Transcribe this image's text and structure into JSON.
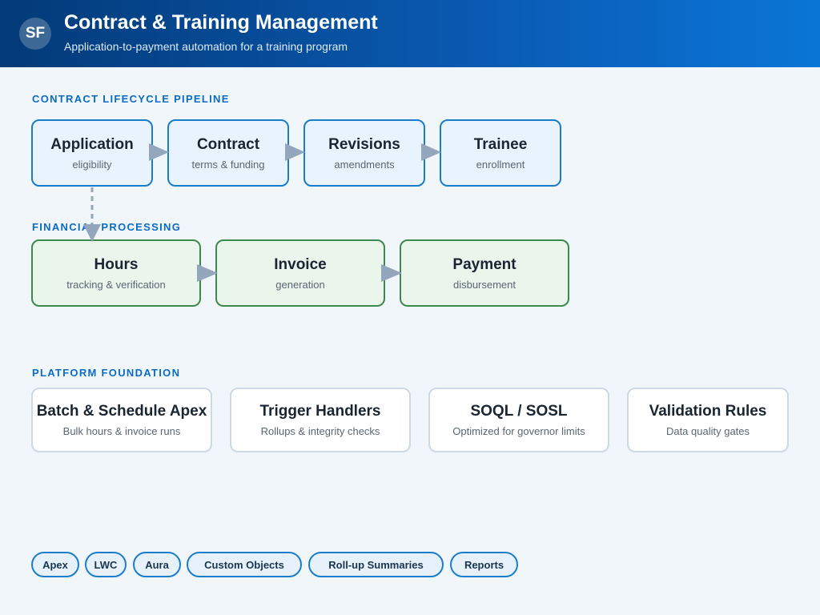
{
  "header": {
    "logo_text": "SF",
    "title": "Contract & Training Management",
    "subtitle": "Application-to-payment automation for a training program"
  },
  "sections": {
    "lifecycle": "CONTRACT LIFECYCLE PIPELINE",
    "financial": "FINANCIAL PROCESSING",
    "platform": "PLATFORM FOUNDATION"
  },
  "lifecycle_nodes": [
    {
      "title": "Application",
      "sub": "eligibility"
    },
    {
      "title": "Contract",
      "sub": "terms & funding"
    },
    {
      "title": "Revisions",
      "sub": "amendments"
    },
    {
      "title": "Trainee",
      "sub": "enrollment"
    }
  ],
  "financial_nodes": [
    {
      "title": "Hours",
      "sub": "tracking & verification"
    },
    {
      "title": "Invoice",
      "sub": "generation"
    },
    {
      "title": "Payment",
      "sub": "disbursement"
    }
  ],
  "platform_nodes": [
    {
      "title": "Batch & Schedule Apex",
      "sub": "Bulk hours & invoice runs"
    },
    {
      "title": "Trigger Handlers",
      "sub": "Rollups & integrity checks"
    },
    {
      "title": "SOQL / SOSL",
      "sub": "Optimized for governor limits"
    },
    {
      "title": "Validation Rules",
      "sub": "Data quality gates"
    }
  ],
  "tags": [
    "Apex",
    "LWC",
    "Aura",
    "Custom Objects",
    "Roll-up Summaries",
    "Reports"
  ],
  "colors": {
    "header_start": "#033a78",
    "header_end": "#0a76d6",
    "accent_blue": "#1a7dcc",
    "accent_green": "#3c8a4c",
    "connector": "#94a6bb"
  }
}
